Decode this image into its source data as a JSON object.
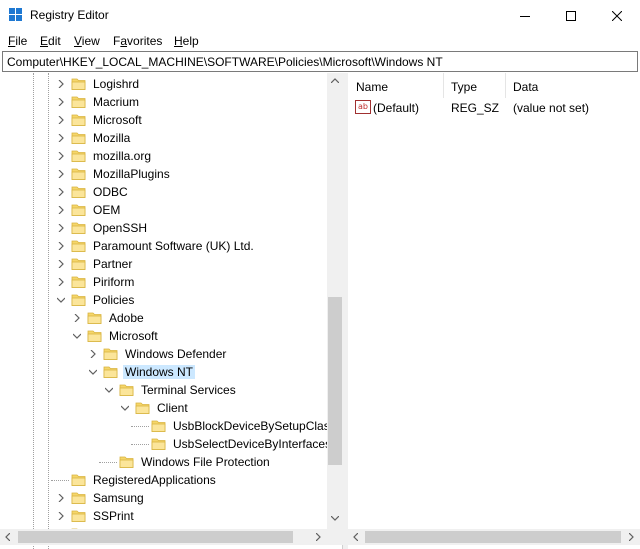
{
  "window": {
    "title": "Registry Editor"
  },
  "menu": [
    {
      "label": "File",
      "accel": "F",
      "rest": "ile"
    },
    {
      "label": "Edit",
      "accel": "E",
      "rest": "dit"
    },
    {
      "label": "View",
      "accel": "V",
      "rest": "iew"
    },
    {
      "label": "Favorites",
      "accel": "a",
      "pre": "F",
      "rest": "vorites"
    },
    {
      "label": "Help",
      "accel": "H",
      "rest": "elp"
    }
  ],
  "address": {
    "path": "Computer\\HKEY_LOCAL_MACHINE\\SOFTWARE\\Policies\\Microsoft\\Windows NT"
  },
  "tree": {
    "items": [
      {
        "label": "Logishrd",
        "depth": 0,
        "expander": "collapsed"
      },
      {
        "label": "Macrium",
        "depth": 0,
        "expander": "collapsed"
      },
      {
        "label": "Microsoft",
        "depth": 0,
        "expander": "collapsed"
      },
      {
        "label": "Mozilla",
        "depth": 0,
        "expander": "collapsed"
      },
      {
        "label": "mozilla.org",
        "depth": 0,
        "expander": "collapsed"
      },
      {
        "label": "MozillaPlugins",
        "depth": 0,
        "expander": "collapsed"
      },
      {
        "label": "ODBC",
        "depth": 0,
        "expander": "collapsed"
      },
      {
        "label": "OEM",
        "depth": 0,
        "expander": "collapsed"
      },
      {
        "label": "OpenSSH",
        "depth": 0,
        "expander": "collapsed"
      },
      {
        "label": "Paramount Software (UK) Ltd.",
        "depth": 0,
        "expander": "collapsed"
      },
      {
        "label": "Partner",
        "depth": 0,
        "expander": "collapsed"
      },
      {
        "label": "Piriform",
        "depth": 0,
        "expander": "collapsed"
      },
      {
        "label": "Policies",
        "depth": 0,
        "expander": "expanded"
      },
      {
        "label": "Adobe",
        "depth": 1,
        "expander": "collapsed"
      },
      {
        "label": "Microsoft",
        "depth": 1,
        "expander": "expanded"
      },
      {
        "label": "Windows Defender",
        "depth": 2,
        "expander": "collapsed"
      },
      {
        "label": "Windows NT",
        "depth": 2,
        "expander": "expanded",
        "selected": true
      },
      {
        "label": "Terminal Services",
        "depth": 3,
        "expander": "expanded"
      },
      {
        "label": "Client",
        "depth": 4,
        "expander": "expanded"
      },
      {
        "label": "UsbBlockDeviceBySetupClass",
        "depth": 5,
        "expander": "none"
      },
      {
        "label": "UsbSelectDeviceByInterfaces",
        "depth": 5,
        "expander": "none"
      },
      {
        "label": "Windows File Protection",
        "depth": 3,
        "expander": "none"
      },
      {
        "label": "RegisteredApplications",
        "depth": 0,
        "expander": "none"
      },
      {
        "label": "Samsung",
        "depth": 0,
        "expander": "collapsed"
      },
      {
        "label": "SSPrint",
        "depth": 0,
        "expander": "collapsed"
      },
      {
        "label": "",
        "depth": 0,
        "expander": "collapsed"
      }
    ]
  },
  "list": {
    "columns": [
      {
        "label": "Name"
      },
      {
        "label": "Type"
      },
      {
        "label": "Data"
      }
    ],
    "rows": [
      {
        "name": "(Default)",
        "type": "REG_SZ",
        "data": "(value not set)",
        "icon": "string-value-icon"
      }
    ]
  },
  "colors": {
    "selection": "#cce8ff",
    "folder": "#f5d66a",
    "folder_edge": "#d9b440",
    "scroll_thumb": "#cdcdcd",
    "scroll_track": "#f0f0f0"
  }
}
